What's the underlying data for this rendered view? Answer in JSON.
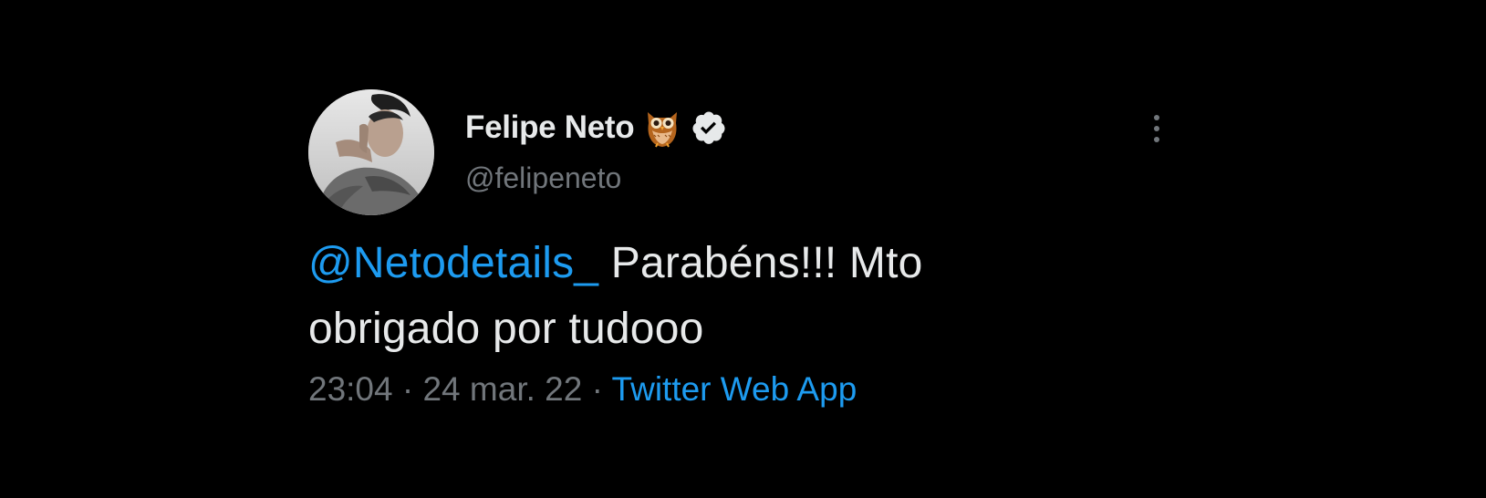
{
  "tweet": {
    "author": {
      "display_name": "Felipe Neto",
      "name_emoji": "owl-emoji",
      "verified_icon": "verified-badge-icon",
      "handle": "@felipeneto"
    },
    "menu_icon": "more-vertical-icon",
    "text": {
      "mention": "@Netodetails_",
      "body_line1": " Parabéns!!! Mto",
      "body_line2": "obrigado por tudooo"
    },
    "meta": {
      "time": "23:04",
      "separator": " · ",
      "date": "24 mar. 22",
      "source": "Twitter Web App"
    }
  },
  "colors": {
    "background": "#000000",
    "primary_text": "#e7e9ea",
    "secondary_text": "#71767b",
    "link": "#1d9bf0"
  }
}
